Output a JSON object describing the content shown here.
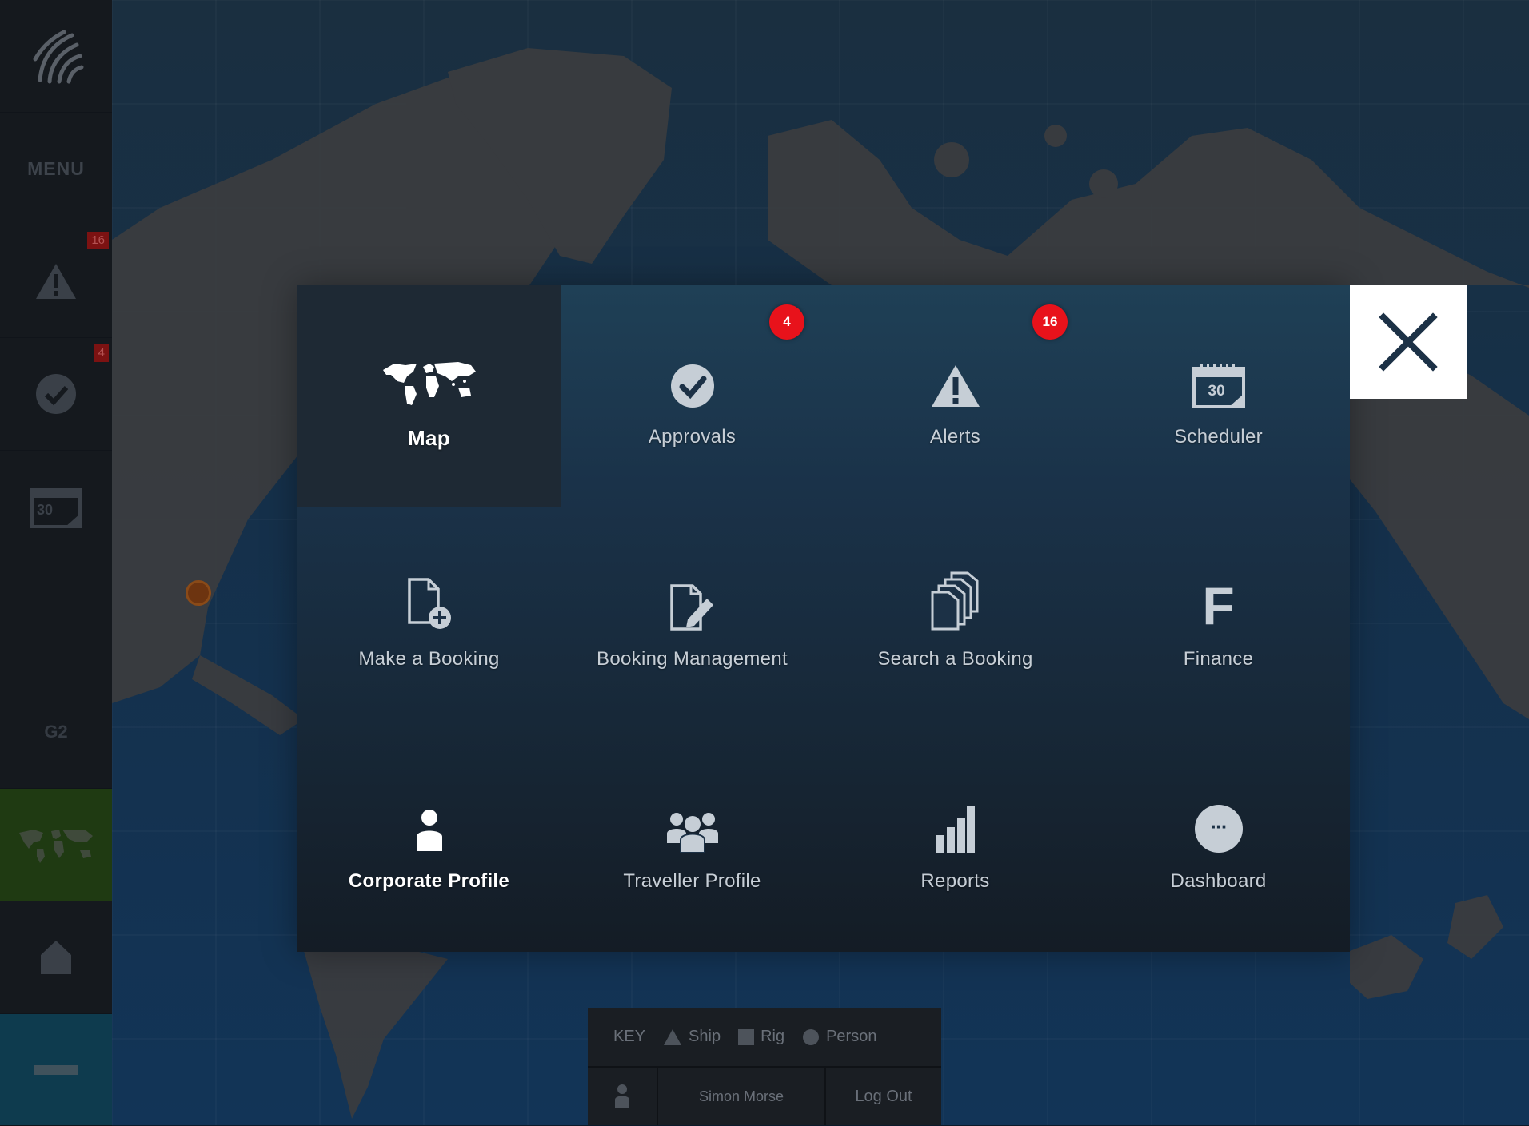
{
  "sidebar": {
    "menu_label": "MENU",
    "items": [
      {
        "icon": "alert-icon",
        "badge": "16"
      },
      {
        "icon": "approval-check-icon",
        "badge": "4"
      },
      {
        "icon": "calendar-icon",
        "calendar_day": "30"
      },
      {
        "label": "G2"
      },
      {
        "icon": "world-map-icon"
      },
      {
        "icon": "home-icon"
      },
      {
        "icon": "minimize-bar-icon"
      }
    ]
  },
  "menu": {
    "tiles": [
      {
        "label": "Map",
        "icon": "world-map-icon",
        "active": true
      },
      {
        "label": "Approvals",
        "icon": "check-circle-icon",
        "badge": "4"
      },
      {
        "label": "Alerts",
        "icon": "warning-triangle-icon",
        "badge": "16"
      },
      {
        "label": "Scheduler",
        "icon": "calendar-icon",
        "calendar_day": "30"
      },
      {
        "label": "Make a Booking",
        "icon": "new-document-icon"
      },
      {
        "label": "Booking Management",
        "icon": "edit-document-icon"
      },
      {
        "label": "Search a Booking",
        "icon": "document-stack-icon"
      },
      {
        "label": "Finance",
        "icon": "finance-f-icon",
        "glyph": "F"
      },
      {
        "label": "Corporate Profile",
        "icon": "person-icon"
      },
      {
        "label": "Traveller Profile",
        "icon": "group-icon"
      },
      {
        "label": "Reports",
        "icon": "bar-chart-icon"
      },
      {
        "label": "Dashboard",
        "icon": "more-circle-icon",
        "glyph": "···"
      }
    ]
  },
  "key": {
    "title": "KEY",
    "items": [
      {
        "label": "Ship",
        "shape": "triangle"
      },
      {
        "label": "Rig",
        "shape": "square"
      },
      {
        "label": "Person",
        "shape": "circle"
      }
    ]
  },
  "user": {
    "name": "Simon Morse",
    "logout_label": "Log Out"
  },
  "colors": {
    "badge_red": "#e8121b",
    "map_active_green": "#1f3a12",
    "minimize_teal": "#0e3b4e"
  }
}
